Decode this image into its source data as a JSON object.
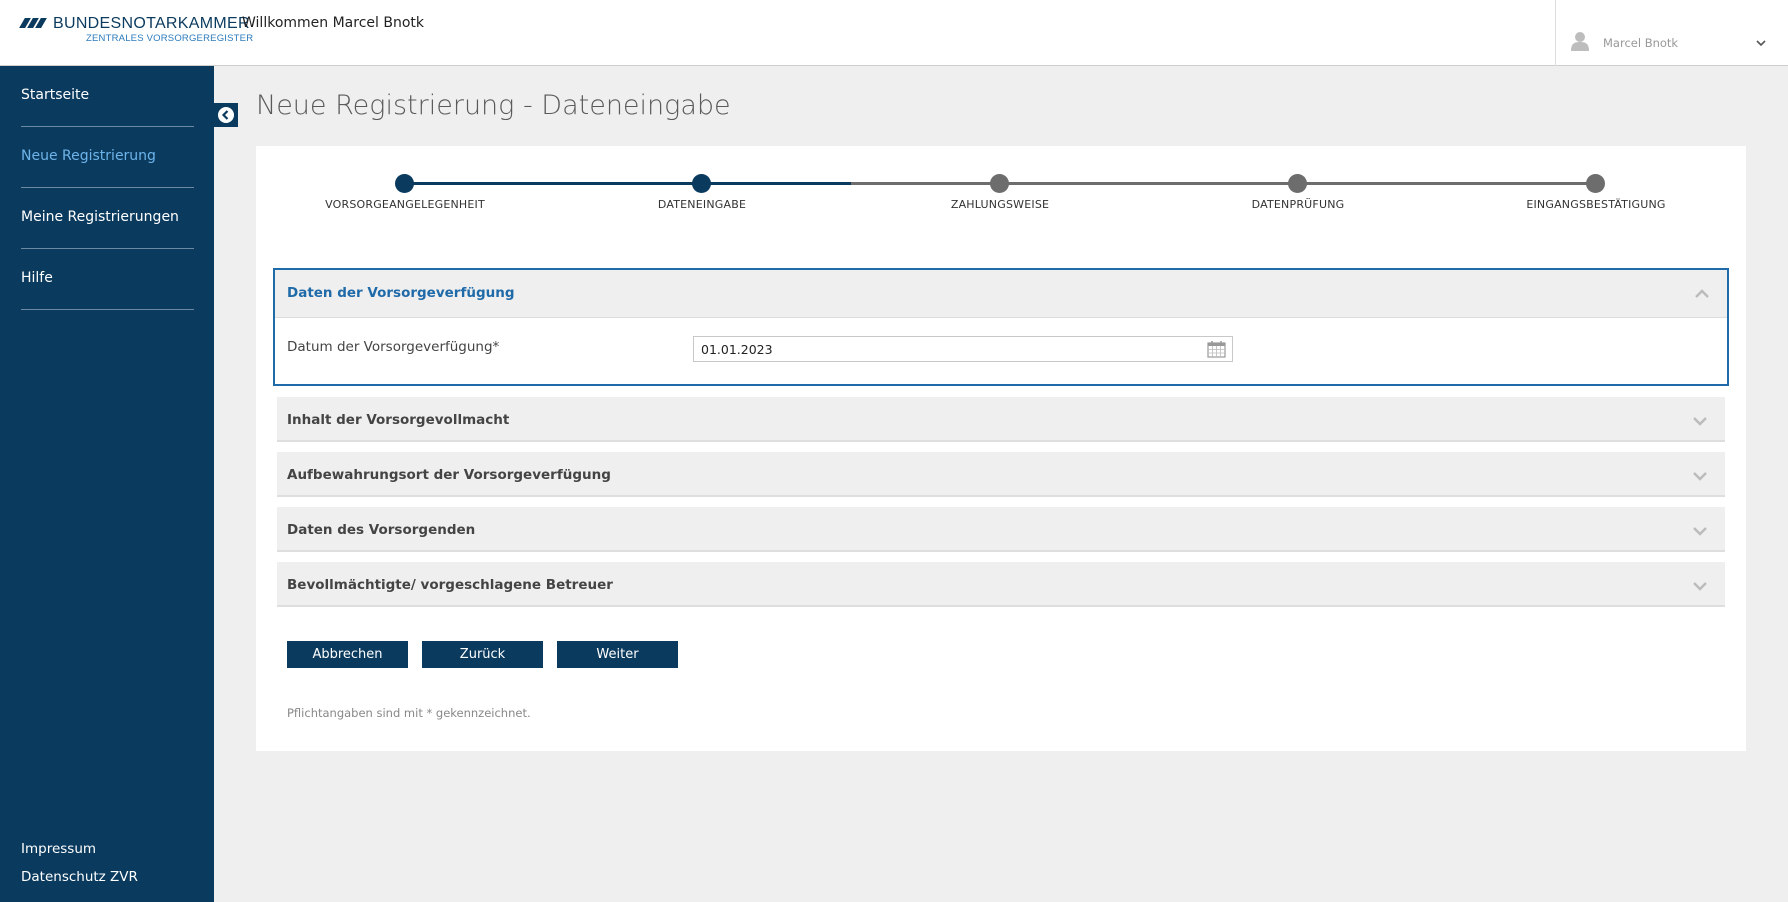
{
  "header": {
    "logo_title": "BUNDESNOTARKAMMER",
    "logo_subtitle": "ZENTRALES VORSORGEREGISTER",
    "welcome": "Willkommen Marcel Bnotk",
    "user_name": "Marcel Bnotk"
  },
  "sidebar": {
    "items": [
      {
        "label": "Startseite",
        "active": false
      },
      {
        "label": "Neue Registrierung",
        "active": true
      },
      {
        "label": "Meine Registrierungen",
        "active": false
      },
      {
        "label": "Hilfe",
        "active": false
      }
    ],
    "footer": [
      "Impressum",
      "Datenschutz ZVR"
    ]
  },
  "page": {
    "title": "Neue Registrierung - Dateneingabe"
  },
  "stepper": {
    "steps": [
      {
        "label": "VORSORGEANGELEGENHEIT",
        "state": "done"
      },
      {
        "label": "DATENEINGABE",
        "state": "current"
      },
      {
        "label": "ZAHLUNGSWEISE",
        "state": "pending"
      },
      {
        "label": "DATENPRÜFUNG",
        "state": "pending"
      },
      {
        "label": "EINGANGSBESTÄTIGUNG",
        "state": "pending"
      }
    ]
  },
  "sections": {
    "open": {
      "title": "Daten der Vorsorgeverfügung",
      "field_label": "Datum der Vorsorgeverfügung*",
      "field_value": "01.01.2023"
    },
    "collapsed": [
      "Inhalt der Vorsorgevollmacht",
      "Aufbewahrungsort der Vorsorgeverfügung",
      "Daten des Vorsorgenden",
      "Bevollmächtigte/ vorgeschlagene Betreuer"
    ]
  },
  "buttons": {
    "cancel": "Abbrechen",
    "back": "Zurück",
    "next": "Weiter"
  },
  "hint": "Pflichtangaben sind mit * gekennzeichnet.",
  "colors": {
    "primary": "#0a3a5e",
    "accent": "#1f6aa8",
    "active_nav": "#6eb4ea",
    "pending": "#6d6d6d"
  }
}
